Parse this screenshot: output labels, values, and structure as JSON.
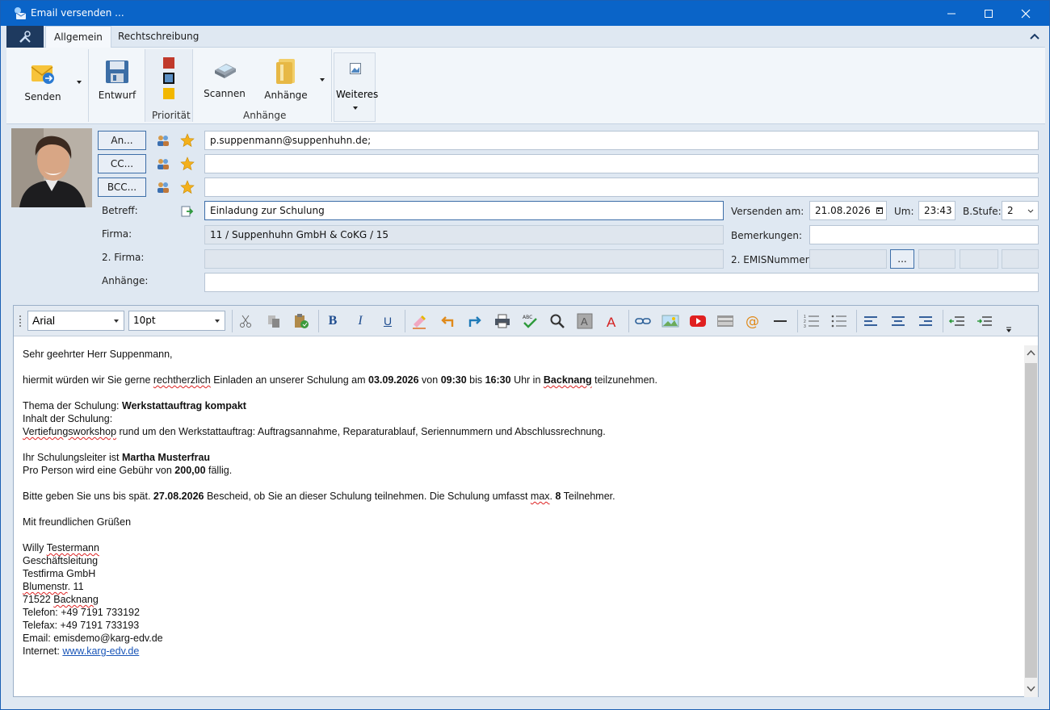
{
  "window": {
    "title": "Email versenden ..."
  },
  "tabs": [
    {
      "label": "Allgemein"
    },
    {
      "label": "Rechtschreibung"
    }
  ],
  "ribbon": {
    "senden": "Senden",
    "entwurf": "Entwurf",
    "prioritaet_group": "Priorität",
    "scannen": "Scannen",
    "anhaenge": "Anhänge",
    "anhaenge_group": "Anhänge",
    "weiteres": "Weiteres"
  },
  "recipients": {
    "an_label": "An...",
    "cc_label": "CC...",
    "bcc_label": "BCC...",
    "an_value": "p.suppenmann@suppenhuhn.de;",
    "cc_value": "",
    "bcc_value": ""
  },
  "fields": {
    "betreff_label": "Betreff:",
    "betreff_value": "Einladung zur Schulung",
    "firma_label": "Firma:",
    "firma_value": "11 / Suppenhuhn GmbH & CoKG / 15",
    "firma2_label": "2. Firma:",
    "firma2_value": "",
    "anhaenge_label": "Anhänge:",
    "anhaenge_value": "",
    "versenden_label": "Versenden am:",
    "versenden_value": "21.08.2026",
    "um_label": "Um:",
    "um_value": "23:43",
    "bstufe_label": "B.Stufe:",
    "bstufe_value": "2",
    "bemerkungen_label": "Bemerkungen:",
    "bemerkungen_value": "",
    "emis_label": "2. EMISNummer:",
    "emis_button": "..."
  },
  "editor": {
    "font": "Arial",
    "size": "10pt"
  },
  "body": {
    "greeting": "Sehr geehrter Herr Suppenmann,",
    "p1_a": "hiermit würden wir Sie gerne ",
    "p1_sp": "rechtherzlich",
    "p1_b": " Einladen an unserer Schulung am ",
    "p1_date": "03.09.2026",
    "p1_c": " von ",
    "p1_from": "09:30",
    "p1_d": " bis ",
    "p1_to": "16:30",
    "p1_e": " Uhr in ",
    "p1_place": "Backnang",
    "p1_f": " teilzunehmen.",
    "thema_label": "Thema der Schulung: ",
    "thema_value": "Werkstattauftrag kompakt",
    "inhalt_label": "Inhalt der Schulung:",
    "inhalt_sp": "Vertiefungsworkshop",
    "inhalt_rest": " rund um den Werkstattauftrag: Auftragsannahme, Reparaturablauf, Seriennummern und Abschlussrechnung.",
    "leiter_label": "Ihr Schulungsleiter ist ",
    "leiter_value": "Martha Musterfrau",
    "gebuehr_a": "Pro Person wird eine Gebühr von ",
    "gebuehr_value": "200,00",
    "gebuehr_b": " fällig.",
    "bitte_a": "Bitte geben Sie uns bis spät. ",
    "bitte_date": "27.08.2026",
    "bitte_b": " Bescheid, ob Sie an dieser Schulung teilnehmen. Die Schulung umfasst ",
    "bitte_max": "max",
    "bitte_c": ". ",
    "bitte_num": "8",
    "bitte_d": " Teilnehmer.",
    "closing": "Mit freundlichen Grüßen",
    "sig_name_a": "Willy ",
    "sig_name_sp": "Testermann",
    "sig_role": "Geschäftsleitung",
    "sig_company": "Testfirma GmbH",
    "sig_street_sp": "Blumenstr",
    "sig_street_rest": ". 11",
    "sig_city_a": "71522 ",
    "sig_city_sp": "Backnang",
    "sig_phone": "Telefon: +49 7191 733192",
    "sig_fax": "Telefax: +49 7191 733193",
    "sig_email": "Email: emisdemo@karg-edv.de",
    "sig_web_label": "Internet: ",
    "sig_web_link": "www.karg-edv.de"
  }
}
